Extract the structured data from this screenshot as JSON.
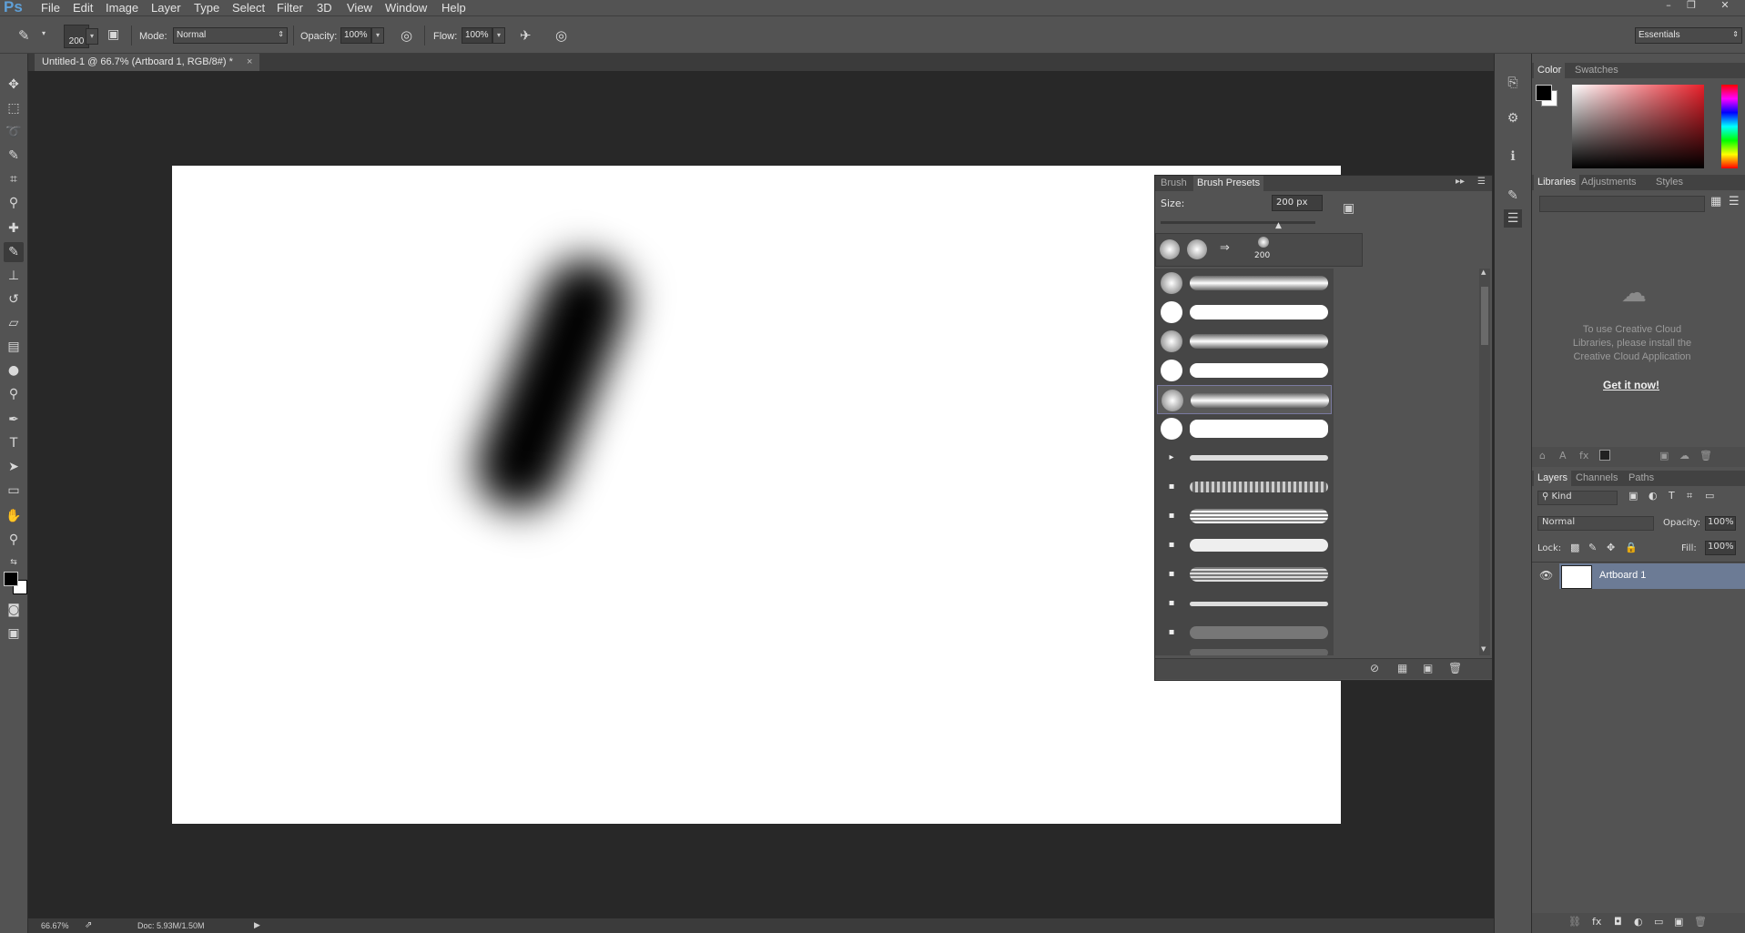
{
  "app": {
    "logo": "Ps"
  },
  "menu": [
    "File",
    "Edit",
    "Image",
    "Layer",
    "Type",
    "Select",
    "Filter",
    "3D",
    "View",
    "Window",
    "Help"
  ],
  "workspace": {
    "label": "Essentials"
  },
  "options": {
    "brush_size": "200",
    "mode_label": "Mode:",
    "mode_value": "Normal",
    "opacity_label": "Opacity:",
    "opacity_value": "100%",
    "flow_label": "Flow:",
    "flow_value": "100%"
  },
  "document": {
    "tab_title": "Untitled-1 @ 66.7% (Artboard 1, RGB/8#) *",
    "close_glyph": "×"
  },
  "status": {
    "zoom": "66.67%",
    "doc": "Doc: 5.93M/1.50M"
  },
  "brush_panel": {
    "tabs": [
      "Brush",
      "Brush Presets"
    ],
    "size_label": "Size:",
    "size_value": "200 px",
    "recent_size": "200"
  },
  "color_panel": {
    "tabs": [
      "Color",
      "Swatches"
    ],
    "fg_color": "#000000",
    "bg_color": "#ffffff"
  },
  "libraries_panel": {
    "tabs": [
      "Libraries",
      "Adjustments",
      "Styles"
    ],
    "message": "To use Creative Cloud Libraries, please install the Creative Cloud Application",
    "link": "Get it now!"
  },
  "layers_panel": {
    "tabs": [
      "Layers",
      "Channels",
      "Paths"
    ],
    "filter_kind": "Kind",
    "blend_mode": "Normal",
    "opacity_label": "Opacity:",
    "opacity_value": "100%",
    "lock_label": "Lock:",
    "fill_label": "Fill:",
    "fill_value": "100%",
    "layers": [
      {
        "name": "Artboard 1"
      }
    ]
  }
}
